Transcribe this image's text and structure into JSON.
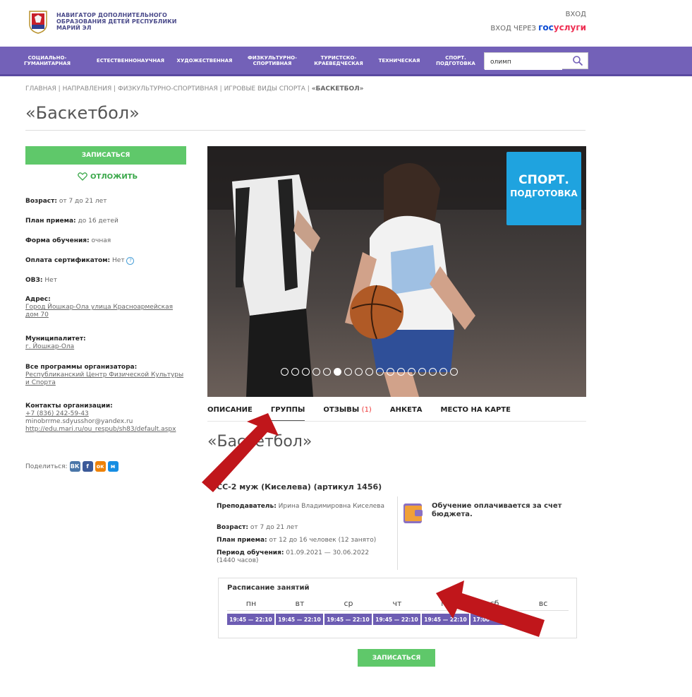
{
  "header": {
    "logo_line1": "НАВИГАТОР ДОПОЛНИТЕЛЬНОГО",
    "logo_line2": "ОБРАЗОВАНИЯ ДЕТЕЙ РЕСПУБЛИКИ",
    "logo_line3": "МАРИЙ ЭЛ",
    "login": "ВХОД",
    "login_via": "ВХОД ЧЕРЕЗ",
    "gos_a": "гос",
    "gos_b": "услуги"
  },
  "nav": {
    "items": [
      {
        "l1": "СОЦИАЛЬНО-",
        "l2": "ГУМАНИТАРНАЯ"
      },
      {
        "l1": "ЕСТЕСТВЕННОНАУЧНАЯ",
        "l2": ""
      },
      {
        "l1": "ХУДОЖЕСТВЕННАЯ",
        "l2": ""
      },
      {
        "l1": "ФИЗКУЛЬТУРНО-",
        "l2": "СПОРТИВНАЯ"
      },
      {
        "l1": "ТУРИСТСКО-",
        "l2": "КРАЕВЕДЧЕСКАЯ"
      },
      {
        "l1": "ТЕХНИЧЕСКАЯ",
        "l2": ""
      },
      {
        "l1": "СПОРТ.",
        "l2": "ПОДГОТОВКА"
      }
    ],
    "search_value": "олимп"
  },
  "breadcrumb": {
    "items": [
      "ГЛАВНАЯ",
      "НАПРАВЛЕНИЯ",
      "ФИЗКУЛЬТУРНО-СПОРТИВНАЯ",
      "ИГРОВЫЕ ВИДЫ СПОРТА"
    ],
    "current": "«БАСКЕТБОЛ»",
    "sep": "|"
  },
  "page_title": "«Баскетбол»",
  "sidebar": {
    "enroll": "ЗАПИСАТЬСЯ",
    "postpone": "ОТЛОЖИТЬ",
    "age_label": "Возраст:",
    "age_value": "от 7 до 21 лет",
    "plan_label": "План приема:",
    "plan_value": "до 16 детей",
    "form_label": "Форма обучения:",
    "form_value": "очная",
    "pay_label": "Оплата сертификатом:",
    "pay_value": "Нет",
    "ovz_label": "ОВЗ:",
    "ovz_value": "Нет",
    "addr_label": "Адрес:",
    "addr_value": "Город Йошкар-Ола улица Красноармейская дом 70",
    "mun_label": "Муниципалитет:",
    "mun_value": "г. Йошкар-Ола",
    "org_label": "Все программы организатора:",
    "org_value": "Республиканский Центр Физической Культуры и Спорта",
    "contacts_label": "Контакты организации:",
    "phone": "+7 (836) 242-59-43",
    "email": "minobrrme.sdyusshor@yandex.ru",
    "site": "http://edu.mari.ru/ou_respub/sh83/default.aspx",
    "share": "Поделиться:",
    "social": [
      "ВК",
      "f",
      "ок",
      "м"
    ]
  },
  "badge": {
    "l1": "СПОРТ.",
    "l2": "ПОДГОТОВКА"
  },
  "slider": {
    "count": 17,
    "active_index": 5
  },
  "tabs": {
    "items": [
      "ОПИСАНИЕ",
      "ГРУППЫ",
      "ОТЗЫВЫ",
      "АНКЕТА",
      "МЕСТО НА КАРТЕ"
    ],
    "reviews_count": "(1)",
    "active": "ГРУППЫ"
  },
  "sub_title": "«Баскетбол»",
  "group": {
    "title": "СС-2 муж (Киселева) (артикул 1456)",
    "teacher_label": "Преподаватель:",
    "teacher_value": "Ирина Владимировна Киселева",
    "age_label": "Возраст:",
    "age_value": "от 7 до 21 лет",
    "plan_label": "План приема:",
    "plan_value": "от 12 до 16 человек (12 занято)",
    "period_label": "Период обучения:",
    "period_value": "01.09.2021 — 30.06.2022 (1440 часов)",
    "budget": "Обучение оплачивается за счет бюджета."
  },
  "schedule": {
    "title": "Расписание занятий",
    "days": [
      "пн",
      "вт",
      "ср",
      "чт",
      "пт",
      "сб",
      "вс"
    ],
    "slots": [
      "19:45 — 22:10",
      "19:45 — 22:10",
      "19:45 — 22:10",
      "19:45 — 22:10",
      "19:45 — 22:10",
      "17:00 — 19:25"
    ]
  },
  "enroll_bottom": "ЗАПИСАТЬСЯ",
  "colors": {
    "nav": "#7361b8",
    "green": "#5fc86a",
    "badge": "#1fa3df",
    "arrow": "#c0161b",
    "slot": "#6d5db3"
  }
}
